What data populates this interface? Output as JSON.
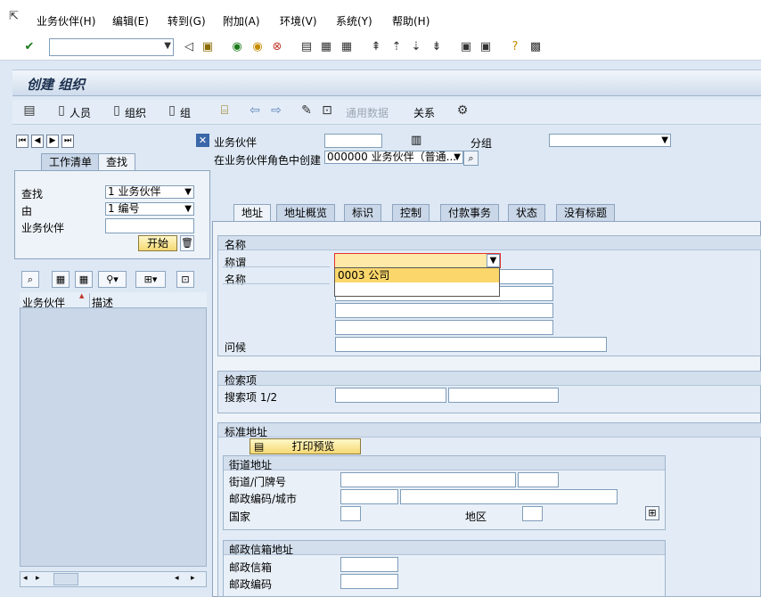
{
  "menu": {
    "items": [
      "业务伙伴(H)",
      "编辑(E)",
      "转到(G)",
      "附加(A)",
      "环境(V)",
      "系统(Y)",
      "帮助(H)"
    ]
  },
  "title": "创建 组织",
  "app_toolbar": {
    "person": "人员",
    "org": "组织",
    "group": "组",
    "general_data": "通用数据",
    "relations": "关系"
  },
  "left": {
    "tab_worklist": "工作清单",
    "tab_find": "查找",
    "find_label": "查找",
    "find_value": "1 业务伙伴",
    "by_label": "由",
    "by_value": "1 编号",
    "bp_label": "业务伙伴",
    "start_button": "开始",
    "col_bp": "业务伙伴",
    "col_desc": "描述"
  },
  "header": {
    "bp_label": "业务伙伴",
    "group_label": "分组",
    "role_label": "在业务伙伴角色中创建",
    "role_value": "000000 业务伙伴（普通..."
  },
  "tabs": [
    "地址",
    "地址概览",
    "标识",
    "控制",
    "付款事务",
    "状态",
    "没有标题"
  ],
  "name_group": {
    "title": "名称",
    "salutation_label": "称谓",
    "name_label": "名称",
    "greeting_label": "问候",
    "dropdown_option": "0003 公司"
  },
  "search_group": {
    "title": "检索项",
    "search_label": "搜索项 1/2"
  },
  "address_group": {
    "title": "标准地址",
    "print_preview": "打印预览",
    "street_group_title": "街道地址",
    "street_label": "街道/门牌号",
    "postal_city_label": "邮政编码/城市",
    "country_label": "国家",
    "region_label": "地区",
    "pobox_group_title": "邮政信箱地址",
    "pobox_label": "邮政信箱",
    "pobox_postal_label": "邮政编码"
  }
}
